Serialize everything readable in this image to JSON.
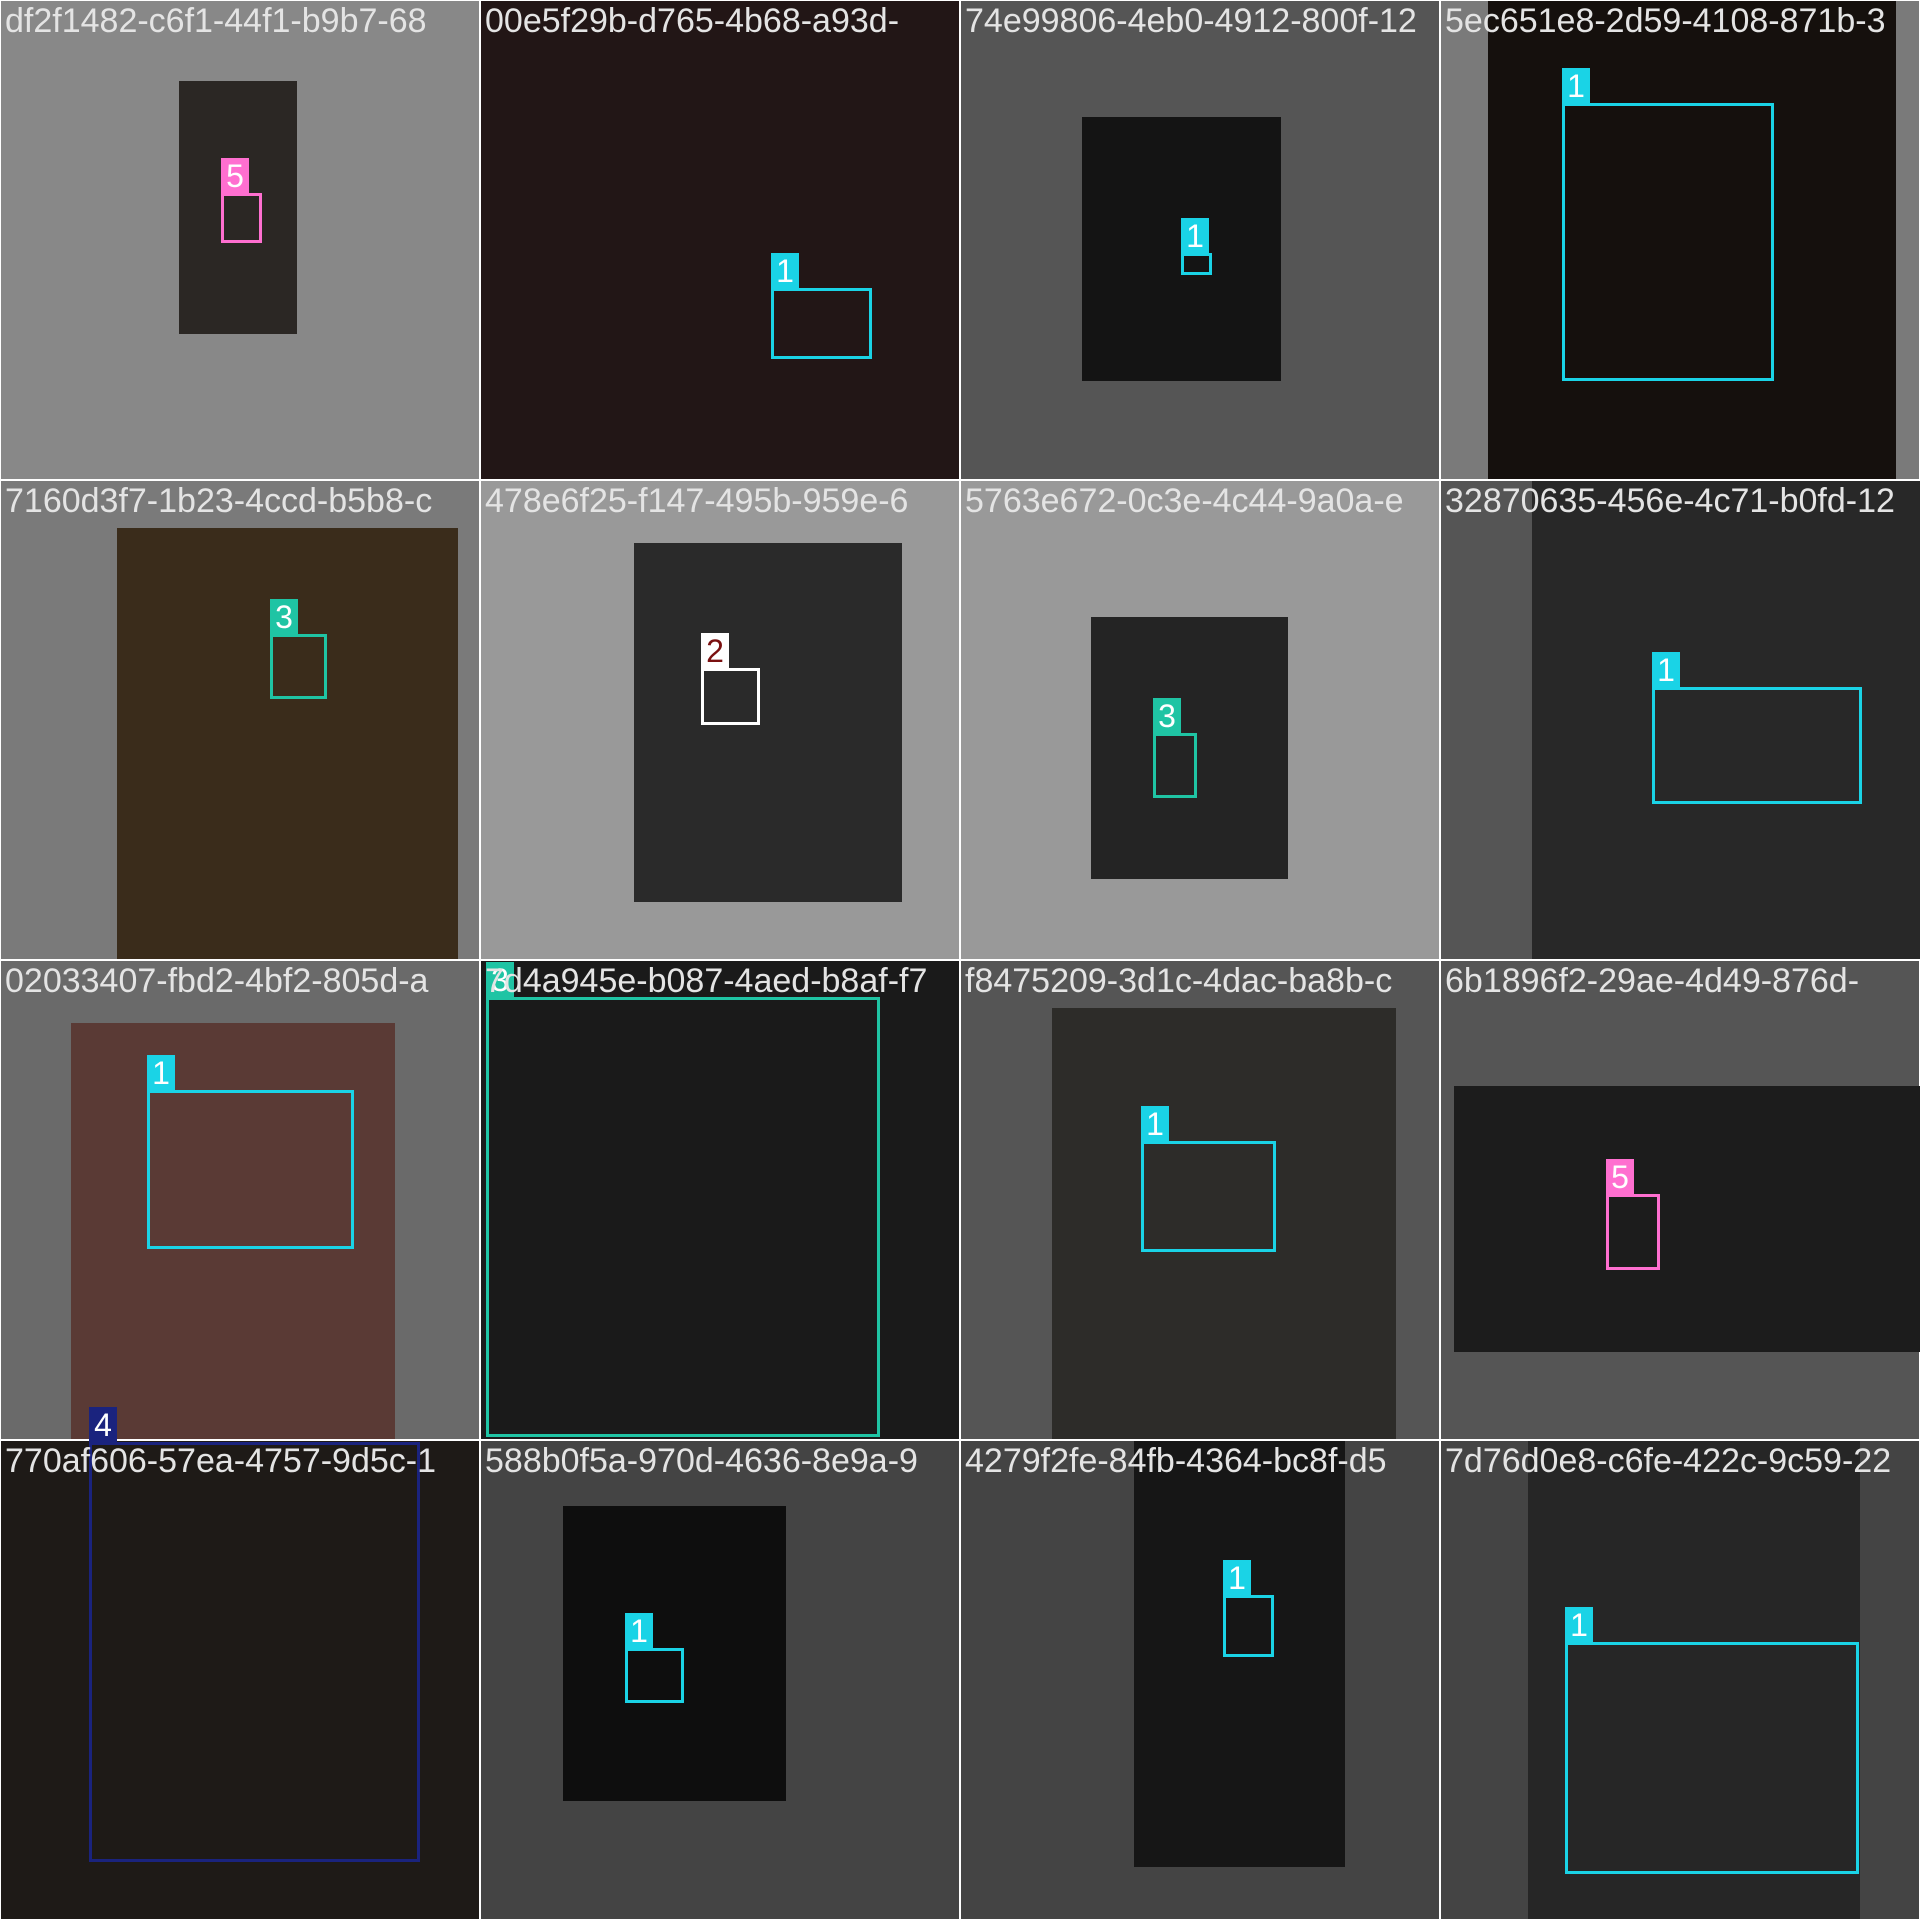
{
  "tiles": [
    {
      "title": "df2f1482-c6f1-44f1-b9b7-68",
      "bg": "#888888",
      "photo": "#2b2724",
      "label": "5",
      "color": "#ff6fd0"
    },
    {
      "title": "00e5f29b-d765-4b68-a93d-",
      "bg": "#1d1515",
      "photo": "#221616",
      "label": "1",
      "color": "#1ad3e6"
    },
    {
      "title": "74e99806-4eb0-4912-800f-12",
      "bg": "#555555",
      "photo": "#141414",
      "label": "1",
      "color": "#1ad3e6"
    },
    {
      "title": "5ec651e8-2d59-4108-871b-3",
      "bg": "#7a7a7a",
      "photo": "#15100d",
      "label": "1",
      "color": "#1ad3e6"
    },
    {
      "title": "7160d3f7-1b23-4ccd-b5b8-c",
      "bg": "#7a7a7a",
      "photo": "#3a2c1b",
      "label": "3",
      "color": "#1fc4a4"
    },
    {
      "title": "478e6f25-f147-495b-959e-6",
      "bg": "#999999",
      "photo": "#2a2a2a",
      "label": "2",
      "color": "#ffffff",
      "label_text_color": "#7a1010"
    },
    {
      "title": "5763e672-0c3e-4c44-9a0a-e",
      "bg": "#999999",
      "photo": "#242424",
      "label": "3",
      "color": "#1fc4a4"
    },
    {
      "title": "32870635-456e-4c71-b0fd-12",
      "bg": "#555555",
      "photo": "#282828",
      "label": "1",
      "color": "#1ad3e6"
    },
    {
      "title": "02033407-fbd2-4bf2-805d-a",
      "bg": "#6a6a6a",
      "photo": "#5a3a35",
      "label": "1",
      "color": "#1ad3e6"
    },
    {
      "title": "7d4a945e-b087-4aed-b8af-f7",
      "bg": "#161616",
      "photo": "#1a1a1a",
      "label": "3",
      "color": "#1fc4a4"
    },
    {
      "title": "f8475209-3d1c-4dac-ba8b-c",
      "bg": "#555555",
      "photo": "#2d2c29",
      "label": "1",
      "color": "#1ad3e6"
    },
    {
      "title": "6b1896f2-29ae-4d49-876d-",
      "bg": "#555555",
      "photo": "#1c1c1c",
      "label": "5",
      "color": "#ff6fd0"
    },
    {
      "title": "770af606-57ea-4757-9d5c-1",
      "bg": "#1e1a17",
      "photo": "#1e1a17",
      "label": "4",
      "color": "#1a237e"
    },
    {
      "title": "588b0f5a-970d-4636-8e9a-9",
      "bg": "#444444",
      "photo": "#0e0e0e",
      "label": "1",
      "color": "#1ad3e6"
    },
    {
      "title": "4279f2fe-84fb-4364-bc8f-d5",
      "bg": "#444444",
      "photo": "#161616",
      "label": "1",
      "color": "#1ad3e6"
    },
    {
      "title": "7d76d0e8-c6fe-422c-9c59-22",
      "bg": "#444444",
      "photo": "#262626",
      "label": "1",
      "color": "#1ad3e6"
    }
  ]
}
